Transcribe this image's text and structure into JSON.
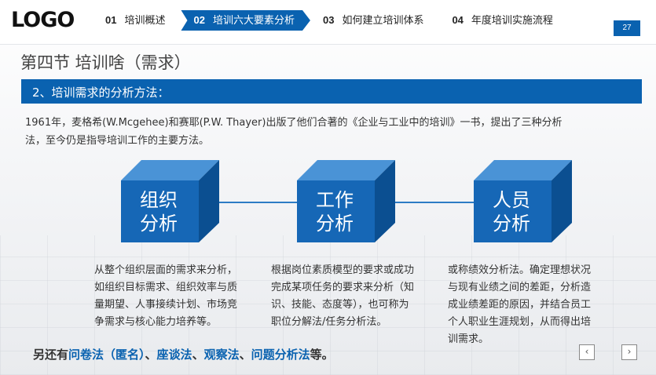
{
  "logo": "LOGO",
  "nav": [
    {
      "num": "01",
      "label": "培训概述",
      "active": false
    },
    {
      "num": "02",
      "label": "培训六大要素分析",
      "active": true
    },
    {
      "num": "03",
      "label": "如何建立培训体系",
      "active": false
    },
    {
      "num": "04",
      "label": "年度培训实施流程",
      "active": false
    }
  ],
  "page_number": "27",
  "section_title": "第四节  培训啥（需求）",
  "subsection_title": "2、培训需求的分析方法：",
  "intro": "1961年，麦格希(W.Mcgehee)和赛耶(P.W. Thayer)出版了他们合著的《企业与工业中的培训》一书，提出了三种分析法，至今仍是指导培训工作的主要方法。",
  "methods": [
    {
      "line1": "组织",
      "line2": "分析",
      "desc": "从整个组织层面的需求来分析，如组织目标需求、组织效率与质量期望、人事接续计划、市场竞争需求与核心能力培养等。"
    },
    {
      "line1": "工作",
      "line2": "分析",
      "desc": "根据岗位素质模型的要求或成功完成某项任务的要求来分析（知识、技能、态度等），也可称为职位分解法/任务分析法。"
    },
    {
      "line1": "人员",
      "line2": "分析",
      "desc": "或称绩效分析法。确定理想状况与现有业绩之间的差距，分析造成业绩差距的原因，并结合员工个人职业生涯规划，从而得出培训需求。"
    }
  ],
  "footer": {
    "prefix": "另还有",
    "methods": "问卷法（匿名）",
    "sep1": "、",
    "m2": "座谈法",
    "sep2": "、",
    "m3": "观察法",
    "sep3": "、",
    "m4": "问题分析法",
    "suffix": "等。"
  },
  "prev_icon": "chevron-left-icon",
  "next_icon": "chevron-right-icon",
  "colors": {
    "accent": "#0a62b0",
    "cube_front": "#1667b6",
    "cube_top": "#4a93d6",
    "cube_side": "#0b4f91"
  }
}
